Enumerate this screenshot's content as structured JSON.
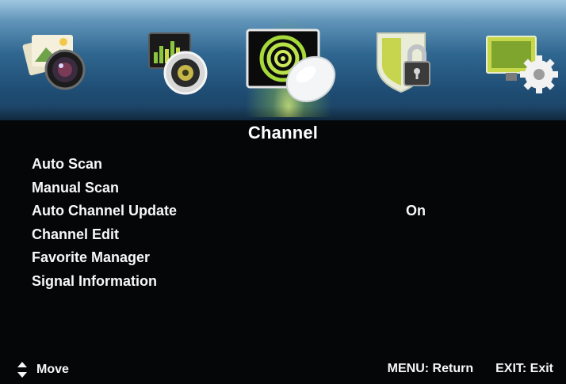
{
  "header": {
    "tabs": [
      {
        "icon": "picture-icon",
        "selected": false
      },
      {
        "icon": "sound-icon",
        "selected": false
      },
      {
        "icon": "channel-icon",
        "selected": true
      },
      {
        "icon": "lock-icon",
        "selected": false
      },
      {
        "icon": "setup-icon",
        "selected": false
      }
    ]
  },
  "section": {
    "title": "Channel"
  },
  "menu": {
    "items": [
      {
        "label": "Auto Scan",
        "value": ""
      },
      {
        "label": "Manual Scan",
        "value": ""
      },
      {
        "label": "Auto Channel Update",
        "value": "On"
      },
      {
        "label": "Channel Edit",
        "value": ""
      },
      {
        "label": "Favorite Manager",
        "value": ""
      },
      {
        "label": "Signal Information",
        "value": ""
      }
    ]
  },
  "footer": {
    "move_label": "Move",
    "menu_return": "MENU: Return",
    "exit_label": "EXIT: Exit"
  },
  "colors": {
    "accent": "#c6e06a",
    "header_blue": "#2f6690"
  }
}
